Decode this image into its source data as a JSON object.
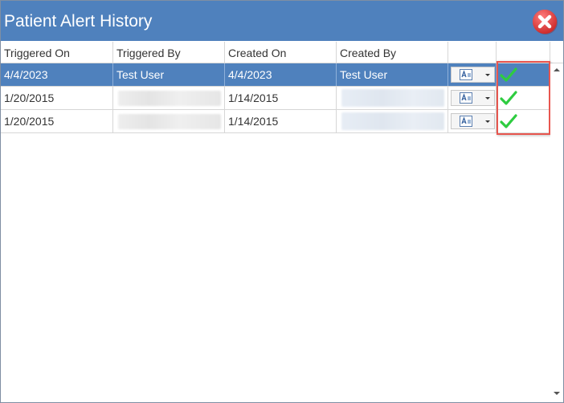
{
  "window": {
    "title": "Patient Alert History",
    "accent_color": "#4f81bd",
    "close_icon": "close-icon"
  },
  "table": {
    "columns": [
      "Triggered On",
      "Triggered By",
      "Created On",
      "Created By",
      "",
      ""
    ],
    "rows": [
      {
        "triggered_on": "4/4/2023",
        "triggered_by": "Test User",
        "created_on": "4/4/2023",
        "created_by": "Test User",
        "selected": true,
        "acknowledged": true
      },
      {
        "triggered_on": "1/20/2015",
        "triggered_by": "",
        "created_on": "1/14/2015",
        "created_by": "",
        "selected": false,
        "acknowledged": true
      },
      {
        "triggered_on": "1/20/2015",
        "triggered_by": "",
        "created_on": "1/14/2015",
        "created_by": "",
        "selected": false,
        "acknowledged": true
      }
    ],
    "action_icon": "document-view-icon",
    "status_icon": "green-check-icon",
    "check_color": "#2ecc40",
    "highlight_color": "#e8564f"
  }
}
